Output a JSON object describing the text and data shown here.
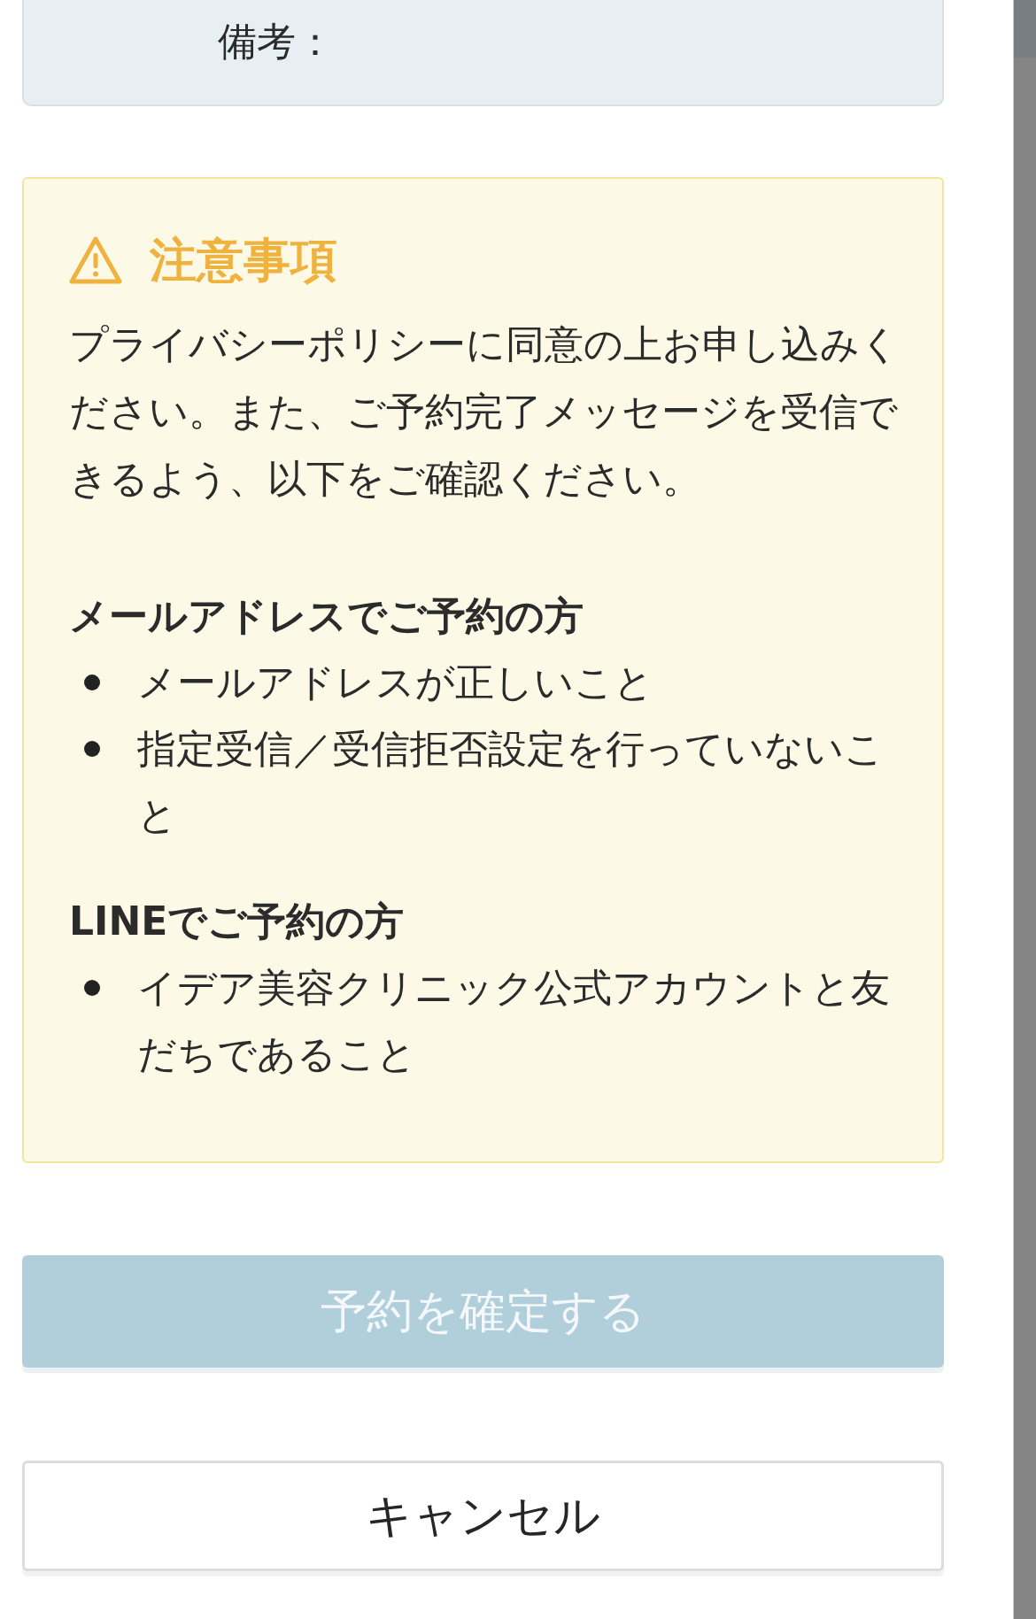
{
  "notes_card": {
    "label": "備考："
  },
  "notice": {
    "title": "注意事項",
    "text": "プライバシーポリシーに同意の上お申し込みください。また、ご予約完了メッセージを受信できるよう、以下をご確認ください。",
    "sections": [
      {
        "heading": "メールアドレスでご予約の方",
        "items": [
          "メールアドレスが正しいこと",
          "指定受信／受信拒否設定を行っていないこと"
        ]
      },
      {
        "heading": "LINEでご予約の方",
        "items": [
          "イデア美容クリニック公式アカウントと友だちであること"
        ]
      }
    ]
  },
  "buttons": [
    {
      "kind": "primary",
      "label": "予約を確定する",
      "disabled": true
    },
    {
      "kind": "secondary",
      "label": "キャンセル"
    }
  ]
}
